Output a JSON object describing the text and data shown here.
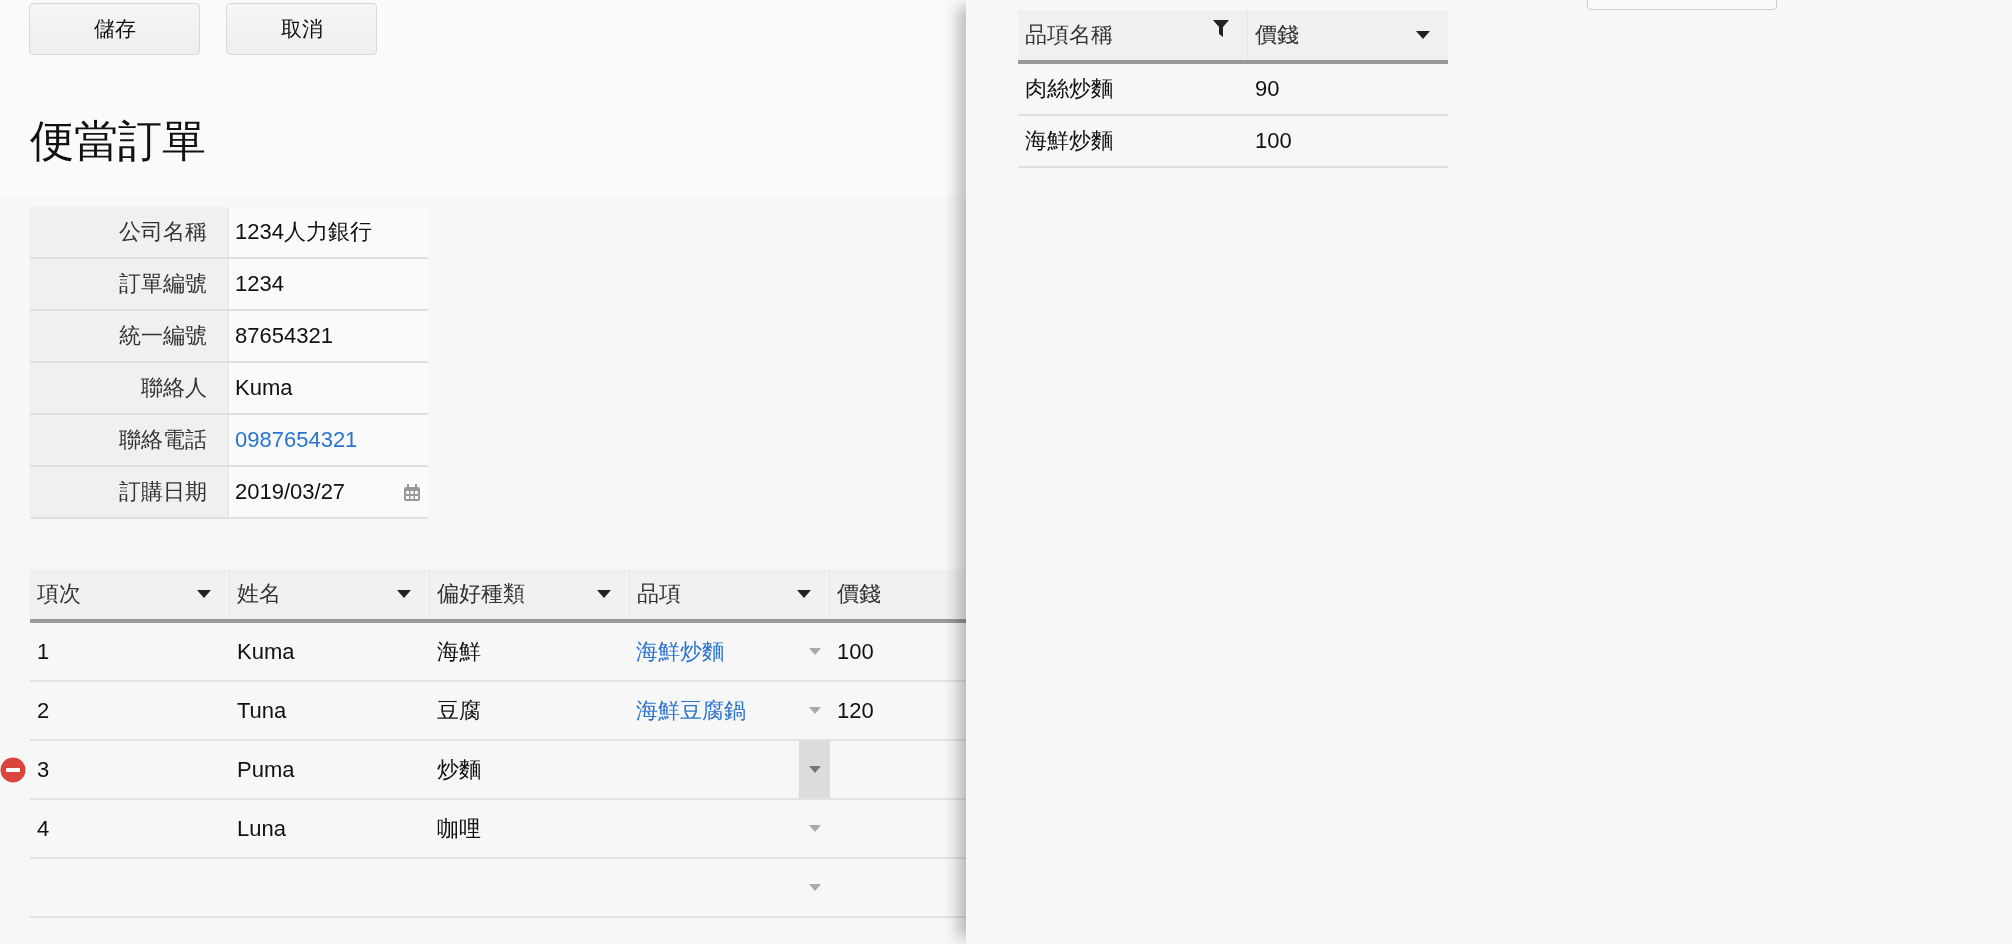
{
  "toolbar": {
    "buttons": [
      "儲存",
      "取消"
    ]
  },
  "title": "便當訂單",
  "form": {
    "fields": [
      {
        "label": "公司名稱",
        "value": "1234人力銀行",
        "kind": "text"
      },
      {
        "label": "訂單編號",
        "value": "1234",
        "kind": "text"
      },
      {
        "label": "統一編號",
        "value": "87654321",
        "kind": "text"
      },
      {
        "label": "聯絡人",
        "value": "Kuma",
        "kind": "text"
      },
      {
        "label": "聯絡電話",
        "value": "0987654321",
        "kind": "phone"
      },
      {
        "label": "訂購日期",
        "value": "2019/03/27",
        "kind": "date"
      }
    ]
  },
  "order_table": {
    "columns": [
      {
        "label": "項次",
        "menu": true
      },
      {
        "label": "姓名",
        "menu": true
      },
      {
        "label": "偏好種類",
        "menu": true
      },
      {
        "label": "品項",
        "menu": true
      },
      {
        "label": "價錢"
      }
    ],
    "rows": [
      {
        "index": "1",
        "name": "Kuma",
        "preference": "海鮮",
        "item": "海鮮炒麵",
        "price": "100",
        "hovered": false
      },
      {
        "index": "2",
        "name": "Tuna",
        "preference": "豆腐",
        "item": "海鮮豆腐鍋",
        "price": "120",
        "hovered": false
      },
      {
        "index": "3",
        "name": "Puma",
        "preference": "炒麵",
        "hovered": true
      },
      {
        "index": "4",
        "name": "Luna",
        "preference": "咖哩",
        "hovered": false
      },
      {
        "hovered": false
      }
    ]
  },
  "lookup_panel": {
    "columns": [
      {
        "label": "品項名稱",
        "filtered": true
      },
      {
        "label": "價錢",
        "filtered": false
      }
    ],
    "rows": [
      {
        "item_name": "肉絲炒麵",
        "price": "90"
      },
      {
        "item_name": "海鮮炒麵",
        "price": "100"
      }
    ]
  }
}
